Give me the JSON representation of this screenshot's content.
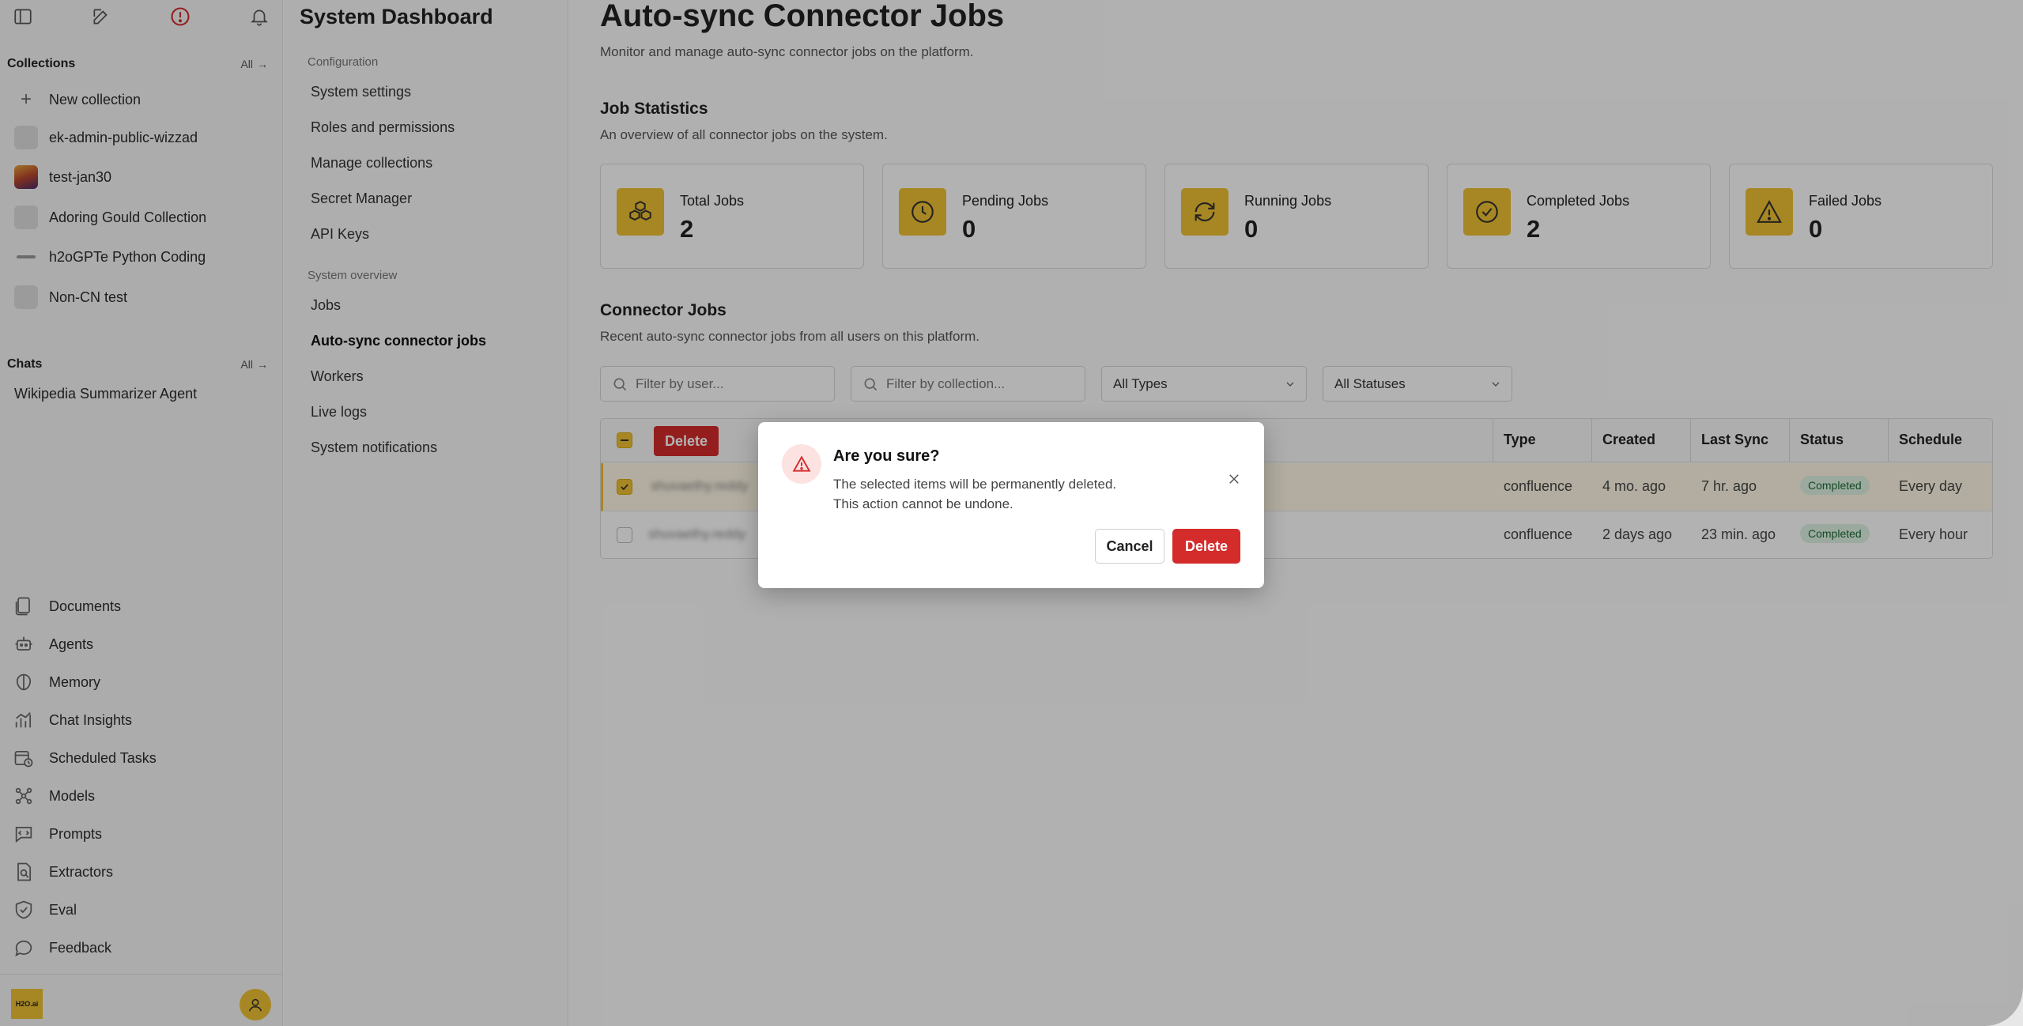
{
  "sidebar": {
    "collections_header": "Collections",
    "collections_all": "All",
    "new_collection": "New collection",
    "collections": [
      {
        "name": "ek-admin-public-wizzad"
      },
      {
        "name": "test-jan30"
      },
      {
        "name": "Adoring Gould Collection"
      },
      {
        "name": "h2oGPTe Python Coding"
      },
      {
        "name": "Non-CN test"
      }
    ],
    "chats_header": "Chats",
    "chats_all": "All",
    "chats": [
      {
        "name": "Wikipedia Summarizer Agent"
      }
    ],
    "nav": [
      {
        "label": "Documents",
        "icon": "documents-icon"
      },
      {
        "label": "Agents",
        "icon": "agents-icon"
      },
      {
        "label": "Memory",
        "icon": "memory-icon"
      },
      {
        "label": "Chat Insights",
        "icon": "chat-insights-icon"
      },
      {
        "label": "Scheduled Tasks",
        "icon": "scheduled-tasks-icon"
      },
      {
        "label": "Models",
        "icon": "models-icon"
      },
      {
        "label": "Prompts",
        "icon": "prompts-icon"
      },
      {
        "label": "Extractors",
        "icon": "extractors-icon"
      },
      {
        "label": "Eval",
        "icon": "eval-icon"
      },
      {
        "label": "Feedback",
        "icon": "feedback-icon"
      }
    ],
    "logo_text": "H2O.ai"
  },
  "subnav": {
    "title": "System Dashboard",
    "config_group": "Configuration",
    "config_items": [
      "System settings",
      "Roles and permissions",
      "Manage collections",
      "Secret Manager",
      "API Keys"
    ],
    "overview_group": "System overview",
    "overview_items": [
      "Jobs",
      "Auto-sync connector jobs",
      "Workers",
      "Live logs",
      "System notifications"
    ]
  },
  "main": {
    "title": "Auto-sync Connector Jobs",
    "subtitle": "Monitor and manage auto-sync connector jobs on the platform.",
    "stats_title": "Job Statistics",
    "stats_desc": "An overview of all connector jobs on the system.",
    "stats": [
      {
        "label": "Total Jobs",
        "value": "2",
        "icon": "cubes-icon"
      },
      {
        "label": "Pending Jobs",
        "value": "0",
        "icon": "clock-icon"
      },
      {
        "label": "Running Jobs",
        "value": "0",
        "icon": "refresh-icon"
      },
      {
        "label": "Completed Jobs",
        "value": "2",
        "icon": "check-circle-icon"
      },
      {
        "label": "Failed Jobs",
        "value": "0",
        "icon": "warning-icon"
      }
    ],
    "jobs_title": "Connector Jobs",
    "jobs_desc": "Recent auto-sync connector jobs from all users on this platform.",
    "filter_user_placeholder": "Filter by user...",
    "filter_collection_placeholder": "Filter by collection...",
    "type_select": "All Types",
    "status_select": "All Statuses",
    "bulk_delete": "Delete",
    "columns": [
      "Type",
      "Created",
      "Last Sync",
      "Status",
      "Schedule"
    ],
    "rows": [
      {
        "user": "shuvaethy.reddy",
        "type": "confluence",
        "created": "4 mo. ago",
        "last_sync": "7 hr. ago",
        "status": "Completed",
        "schedule": "Every day",
        "selected": true
      },
      {
        "user": "shuvaethy.reddy",
        "type": "confluence",
        "created": "2 days ago",
        "last_sync": "23 min. ago",
        "status": "Completed",
        "schedule": "Every hour",
        "selected": false
      }
    ]
  },
  "dialog": {
    "title": "Are you sure?",
    "message_line1": "The selected items will be permanently deleted.",
    "message_line2": "This action cannot be undone.",
    "cancel": "Cancel",
    "delete": "Delete"
  },
  "colors": {
    "accent": "#f0c233",
    "danger": "#d42b2b",
    "success_bg": "#dff3e3",
    "success_text": "#1d6b34"
  }
}
